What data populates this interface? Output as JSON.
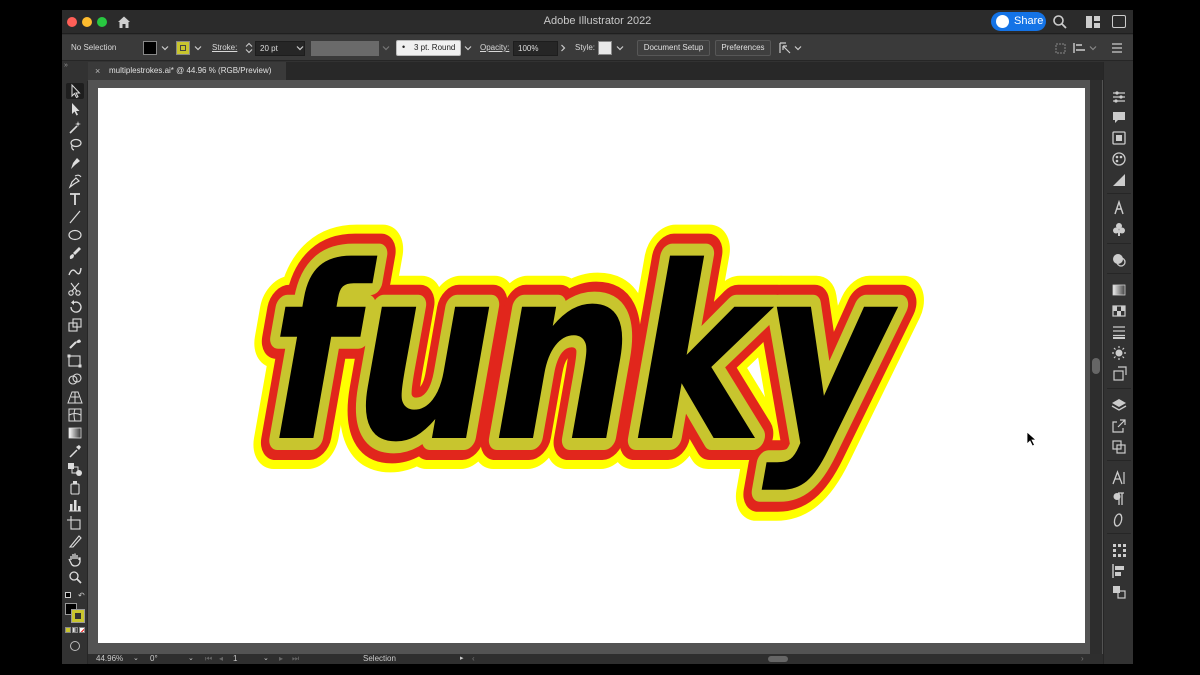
{
  "window": {
    "title": "Adobe Illustrator 2022"
  },
  "header": {
    "share_label": "Share"
  },
  "control_bar": {
    "selection_label": "No Selection",
    "fill_color": "#000000",
    "stroke_color": "#c8c52e",
    "stroke_label": "Stroke:",
    "stroke_weight": "20 pt",
    "brush_label": "3 pt. Round",
    "opacity_label": "Opacity:",
    "opacity_value": "100%",
    "style_label": "Style:",
    "document_setup_label": "Document Setup",
    "preferences_label": "Preferences"
  },
  "document_tab": {
    "close_symbol": "×",
    "title": "multiplestrokes.ai* @ 44.96 % (RGB/Preview)"
  },
  "artwork": {
    "text": "funky",
    "fill_color": "#000000",
    "inner_stroke_color": "#c8c52e",
    "middle_stroke_color": "#e1261c",
    "outer_stroke_color": "#ffff00"
  },
  "status_bar": {
    "zoom": "44.96%",
    "rotation": "0°",
    "artboard_number": "1",
    "tool_name": "Selection"
  },
  "colors": {
    "ui_dark": "#323232",
    "canvas": "#535353",
    "accent": "#1473e6"
  }
}
